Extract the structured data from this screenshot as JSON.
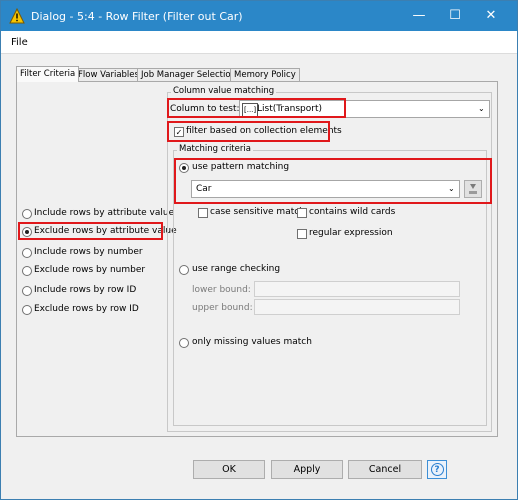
{
  "window": {
    "title": "Dialog - 5:4 - Row Filter (Filter out Car)",
    "minimize_glyph": "—",
    "maximize_glyph": "☐",
    "close_glyph": "✕"
  },
  "menu": {
    "file": "File"
  },
  "tabs": [
    "Filter Criteria",
    "Flow Variables",
    "Job Manager Selection",
    "Memory Policy"
  ],
  "mode_options": [
    "Include rows by attribute value",
    "Exclude rows by attribute value",
    "Include rows by number",
    "Exclude rows by number",
    "Include rows by row ID",
    "Exclude rows by row ID"
  ],
  "selected_mode": "Exclude rows by attribute value",
  "column_value_matching": {
    "title": "Column value matching",
    "column_label": "Column to test:",
    "column_icon_text": "[...]",
    "column_value": "List(Transport)",
    "filter_collection": "filter based on collection elements"
  },
  "matching_criteria": {
    "title": "Matching criteria",
    "pattern_label": "use pattern matching",
    "pattern_value": "Car",
    "case_sensitive": "case sensitive match",
    "wild_cards": "contains wild cards",
    "regex": "regular expression",
    "range_label": "use range checking",
    "lower": "lower bound:",
    "upper": "upper bound:",
    "missing": "only missing values match"
  },
  "buttons": {
    "ok": "OK",
    "apply": "Apply",
    "cancel": "Cancel",
    "help": "?"
  },
  "colors": {
    "titlebar": "#2b87c8",
    "highlight": "#e0181b"
  }
}
